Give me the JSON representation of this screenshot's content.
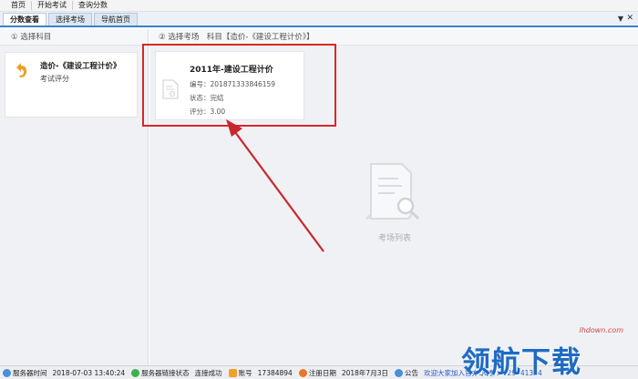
{
  "menubar": {
    "items": [
      {
        "label": "首页"
      },
      {
        "label": "开始考试"
      },
      {
        "label": "查询分数"
      }
    ]
  },
  "tabs": [
    {
      "label": "分数查看",
      "active": true
    },
    {
      "label": "选择考场",
      "active": false
    },
    {
      "label": "导航首页",
      "active": false
    }
  ],
  "left_panel": {
    "header": "① 选择科目",
    "subject": {
      "name": "造价-《建设工程计价》",
      "subtitle": "考试评分",
      "icon": "back-arrow-icon"
    }
  },
  "right_panel": {
    "header": "② 选择考场　科目【造价-《建设工程计价》】",
    "exam_card": {
      "title": "2011年-建设工程计价",
      "number_label": "编号：",
      "number_value": "2018713338461​59",
      "status_label": "状态：",
      "status_value": "完结",
      "score_label": "评分：",
      "score_value": "3.00",
      "icon": "document-icon"
    },
    "empty_state": {
      "label": "考场列表",
      "icon": "document-search-icon"
    }
  },
  "statusbar": {
    "server_time_label": "服务器时间",
    "server_time_value": "2018-07-03 13:40:24",
    "connection_label": "服务器链接状态",
    "connection_value": "连接成功",
    "account_label": "账号",
    "account_value": "17384894",
    "register_label": "注册日期",
    "register_value": "2018年7月3日",
    "notice_label": "公告",
    "notice_value": "欢迎大家加入官方QQ群：129841334"
  },
  "watermark": {
    "text": "领航下载",
    "url": "lhdown.com"
  },
  "colors": {
    "tab_accent": "#3e7fc8",
    "highlight": "#d8262c",
    "icon_orange": "#f0a02a"
  }
}
